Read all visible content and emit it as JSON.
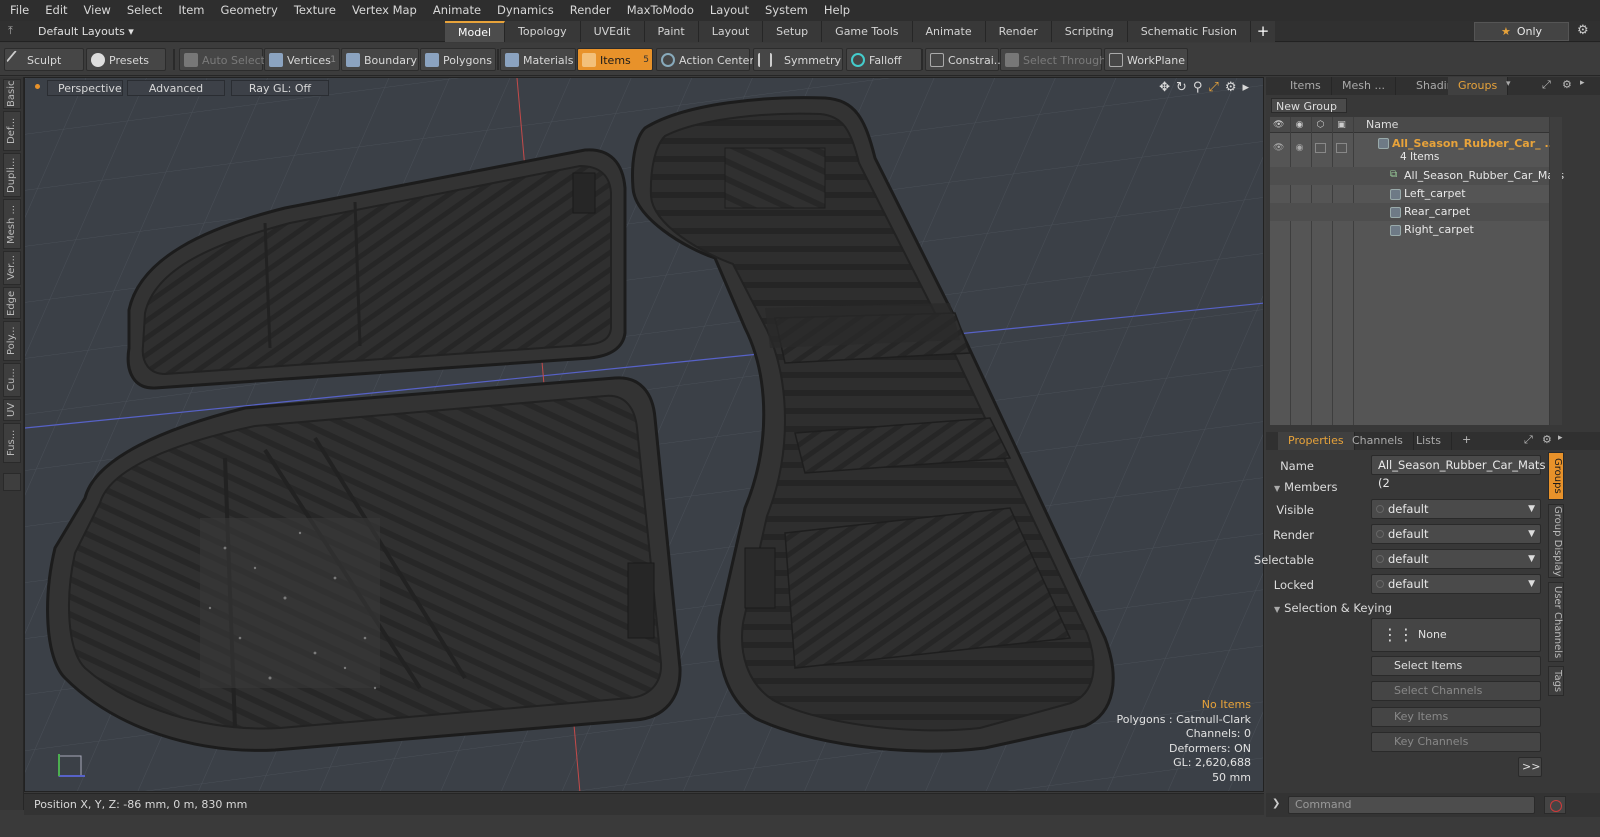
{
  "menu": [
    "File",
    "Edit",
    "View",
    "Select",
    "Item",
    "Geometry",
    "Texture",
    "Vertex Map",
    "Animate",
    "Dynamics",
    "Render",
    "MaxToModo",
    "Layout",
    "System",
    "Help"
  ],
  "layoutbar": {
    "layouts_label": "Default Layouts ▾",
    "tabs": [
      "Model",
      "Topology",
      "UVEdit",
      "Paint",
      "Layout",
      "Setup",
      "Game Tools",
      "Animate",
      "Render",
      "Scripting",
      "Schematic Fusion"
    ],
    "active_tab": "Model",
    "only_label": "Only"
  },
  "toolbar": {
    "sculpt": "Sculpt",
    "presets": "Presets",
    "auto_select": "Auto Select",
    "vertices": "Vertices",
    "vertices_count": "1",
    "boundary": "Boundary",
    "polygons": "Polygons",
    "materials": "Materials",
    "items": "Items",
    "items_count": "5",
    "action_center": "Action Center",
    "symmetry": "Symmetry",
    "falloff": "Falloff",
    "constraints": "Constrai...",
    "select_through": "Select Through",
    "workplane": "WorkPlane"
  },
  "left_tabs": [
    "Basic",
    "Def...",
    "Dupli...",
    "Mesh ...",
    "Ver...",
    "Edge",
    "Poly...",
    "Cu...",
    "UV",
    "Fus..."
  ],
  "viewport": {
    "view_mode": "Perspective",
    "shading": "Advanced",
    "raygl": "Ray GL: Off",
    "info": {
      "selection": "No Items",
      "polygons": "Polygons : Catmull-Clark",
      "channels": "Channels: 0",
      "deformers": "Deformers: ON",
      "gl": "GL: 2,620,688",
      "scale": "50 mm"
    }
  },
  "status": {
    "position": "Position X, Y, Z:  -86 mm, 0 m, 830 mm"
  },
  "right_panel": {
    "tabs": [
      "Items",
      "Mesh ...",
      "Shading",
      "Groups"
    ],
    "active_tab": "Groups",
    "new_group": "New Group",
    "column_name": "Name",
    "group": {
      "name": "All_Season_Rubber_Car_ ...",
      "count": "4 Items"
    },
    "items": [
      "All_Season_Rubber_Car_Mats",
      "Left_carpet",
      "Rear_carpet",
      "Right_carpet"
    ],
    "prop_tabs": [
      "Properties",
      "Channels",
      "Lists"
    ],
    "prop_active": "Properties",
    "name_label": "Name",
    "name_value": "All_Season_Rubber_Car_Mats (2",
    "members_section": "Members",
    "members": [
      {
        "label": "Visible",
        "value": "default"
      },
      {
        "label": "Render",
        "value": "default"
      },
      {
        "label": "Selectable",
        "value": "default"
      },
      {
        "label": "Locked",
        "value": "default"
      }
    ],
    "selection_section": "Selection & Keying",
    "none_label": "None",
    "select_items": "Select Items",
    "select_channels": "Select Channels",
    "key_items": "Key Items",
    "key_channels": "Key Channels",
    "more": ">>",
    "vtabs": [
      "Groups",
      "Group Display",
      "User Channels",
      "Tags"
    ],
    "command_placeholder": "Command"
  },
  "colors": {
    "accent": "#e8922a",
    "viewport_bg": "#3b4047",
    "panel_bg": "#383838"
  }
}
